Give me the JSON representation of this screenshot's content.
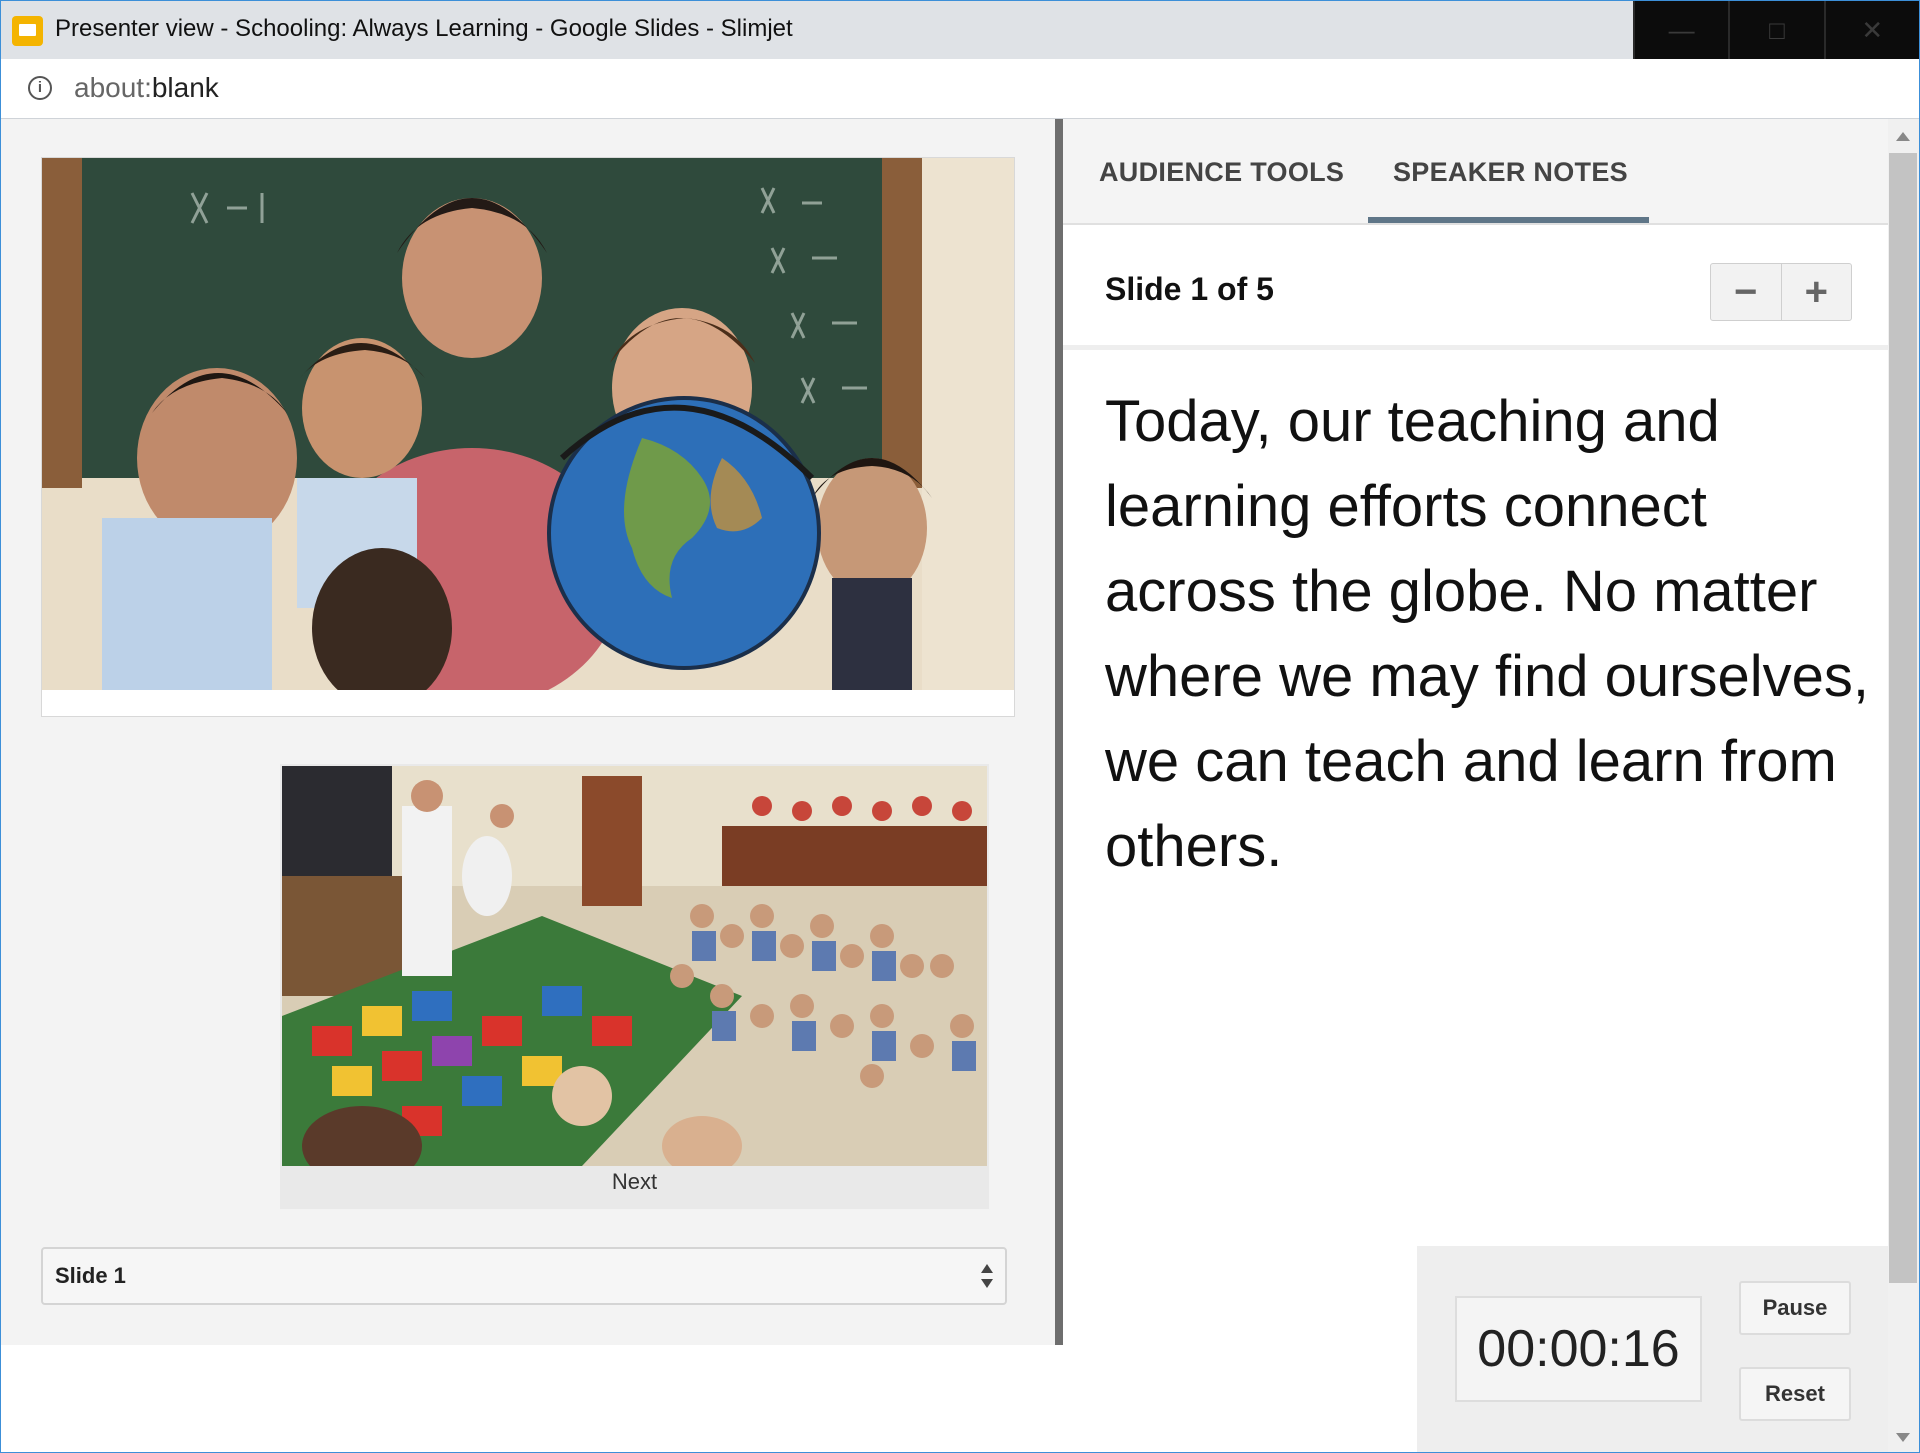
{
  "window": {
    "title": "Presenter view - Schooling: Always Learning - Google Slides - Slimjet",
    "controls": [
      "minimize",
      "maximize",
      "close"
    ]
  },
  "address_bar": {
    "url_scheme": "about:",
    "url_rest": "blank"
  },
  "left_pane": {
    "next_label": "Next",
    "slide_select_value": "Slide 1"
  },
  "tabs": [
    {
      "label": "AUDIENCE TOOLS",
      "active": false
    },
    {
      "label": "SPEAKER NOTES",
      "active": true
    }
  ],
  "notes": {
    "slide_count": "Slide 1 of 5",
    "zoom_out": "−",
    "zoom_in": "+",
    "text": "Today, our teaching and learning efforts connect across the globe. No matter where we may find ourselves, we can teach and learn from others."
  },
  "timer": {
    "value": "00:00:16",
    "pause_label": "Pause",
    "reset_label": "Reset"
  },
  "colors": {
    "accent": "#5f7688",
    "app_icon": "#f4b400",
    "divider": "#6e6e6e"
  }
}
